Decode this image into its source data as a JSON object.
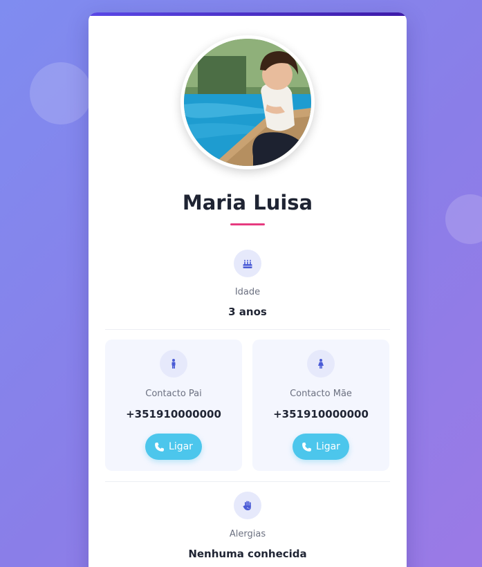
{
  "profile": {
    "name": "Maria Luisa"
  },
  "age": {
    "icon": "birthday-cake-icon",
    "label": "Idade",
    "value": "3 anos"
  },
  "contacts": [
    {
      "icon": "male-person-icon",
      "label": "Contacto Pai",
      "phone": "+351910000000",
      "button_label": "Ligar",
      "button_icon": "phone-icon"
    },
    {
      "icon": "female-person-icon",
      "label": "Contacto Mãe",
      "phone": "+351910000000",
      "button_label": "Ligar",
      "button_icon": "phone-icon"
    }
  ],
  "allergies": {
    "icon": "hand-icon",
    "label": "Alergias",
    "value": "Nenhuma conhecida"
  },
  "colors": {
    "accent": "#4a5bd6",
    "call_button": "#4cc6ec",
    "name_underline": "#e63a7f"
  }
}
